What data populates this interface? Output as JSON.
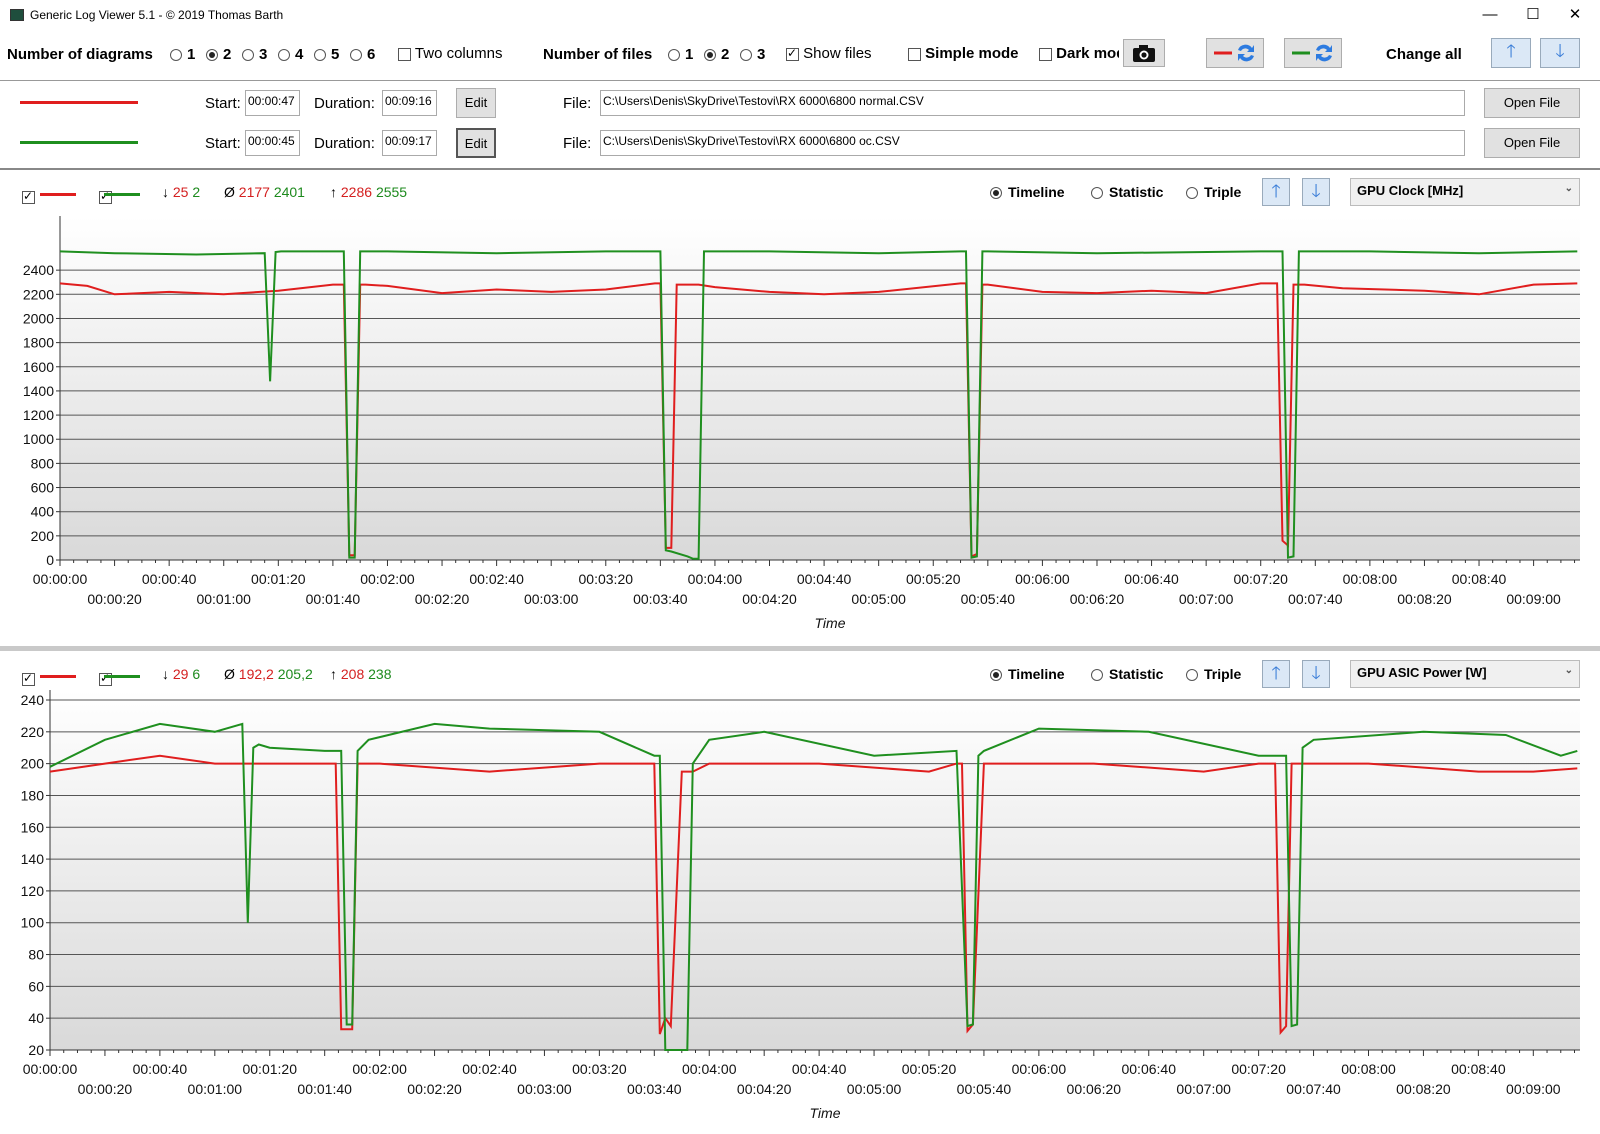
{
  "window": {
    "title": "Generic Log Viewer 5.1 - © 2019 Thomas Barth",
    "minimize": "—",
    "maximize": "☐",
    "close": "✕"
  },
  "toolbar": {
    "num_diagrams_label": "Number of diagrams",
    "diagram_options": [
      "1",
      "2",
      "3",
      "4",
      "5",
      "6"
    ],
    "diagram_selected": "2",
    "two_columns_label": "Two columns",
    "num_files_label": "Number of files",
    "file_options": [
      "1",
      "2",
      "3"
    ],
    "file_selected": "2",
    "show_files_label": "Show files",
    "show_files_checked": true,
    "simple_mode_label": "Simple mode",
    "dark_mode_label": "Dark mod",
    "change_all_label": "Change all"
  },
  "files": [
    {
      "color": "#e01e1e",
      "start_label": "Start:",
      "start": "00:00:47",
      "duration_label": "Duration:",
      "duration": "00:09:16",
      "edit": "Edit",
      "file_label": "File:",
      "path": "C:\\Users\\Denis\\SkyDrive\\Testovi\\RX 6000\\6800 normal.CSV",
      "open": "Open File"
    },
    {
      "color": "#1f8f1f",
      "start_label": "Start:",
      "start": "00:00:45",
      "duration_label": "Duration:",
      "duration": "00:09:17",
      "edit": "Edit",
      "file_label": "File:",
      "path": "C:\\Users\\Denis\\SkyDrive\\Testovi\\RX 6000\\6800 oc.CSV",
      "open": "Open File"
    }
  ],
  "diagrams": [
    {
      "stats": {
        "min_red": "25",
        "min_green": "2",
        "avg_red": "2177",
        "avg_green": "2401",
        "max_red": "2286",
        "max_green": "2555",
        "min_sym": "↓",
        "avg_sym": "Ø",
        "max_sym": "↑"
      },
      "modes": [
        "Timeline",
        "Statistic",
        "Triple"
      ],
      "mode_selected": "Timeline",
      "sensor": "GPU Clock [MHz]",
      "xlabel": "Time"
    },
    {
      "stats": {
        "min_red": "29",
        "min_green": "6",
        "avg_red": "192,2",
        "avg_green": "205,2",
        "max_red": "208",
        "max_green": "238",
        "min_sym": "↓",
        "avg_sym": "Ø",
        "max_sym": "↑"
      },
      "modes": [
        "Timeline",
        "Statistic",
        "Triple"
      ],
      "mode_selected": "Timeline",
      "sensor": "GPU ASIC Power [W]",
      "xlabel": "Time"
    }
  ],
  "chart_data": [
    {
      "type": "line",
      "ylim": [
        0,
        2600
      ],
      "yticks": [
        0,
        200,
        400,
        600,
        800,
        1000,
        1200,
        1400,
        1600,
        1800,
        2000,
        2200,
        2400
      ],
      "xlim": [
        0,
        557
      ],
      "xticks_top": [
        "00:00:00",
        "00:00:40",
        "00:01:20",
        "00:02:00",
        "00:02:40",
        "00:03:20",
        "00:04:00",
        "00:04:40",
        "00:05:20",
        "00:06:00",
        "00:06:40",
        "00:07:20",
        "00:08:00",
        "00:08:40"
      ],
      "xticks_bottom": [
        "00:00:20",
        "00:01:00",
        "00:01:40",
        "00:02:20",
        "00:03:00",
        "00:03:40",
        "00:04:20",
        "00:05:00",
        "00:05:40",
        "00:06:20",
        "00:07:00",
        "00:07:40",
        "00:08:20",
        "00:09:00"
      ],
      "xlabel": "Time",
      "ylabel": "GPU Clock [MHz]",
      "grid": true,
      "series": [
        {
          "name": "6800 normal.CSV",
          "color": "#e01e1e",
          "x": [
            0,
            10,
            20,
            40,
            60,
            80,
            100,
            104,
            106,
            108,
            110,
            112,
            120,
            140,
            160,
            180,
            200,
            218,
            220,
            222,
            224,
            226,
            234,
            240,
            260,
            280,
            300,
            330,
            332,
            334,
            336,
            338,
            340,
            360,
            380,
            400,
            420,
            440,
            446,
            448,
            450,
            452,
            454,
            456,
            470,
            500,
            520,
            540,
            556
          ],
          "y": [
            2290,
            2270,
            2200,
            2220,
            2200,
            2230,
            2280,
            2280,
            40,
            40,
            2280,
            2280,
            2270,
            2210,
            2240,
            2220,
            2240,
            2290,
            2290,
            100,
            100,
            2280,
            2280,
            2260,
            2220,
            2200,
            2220,
            2290,
            2290,
            30,
            50,
            2280,
            2280,
            2220,
            2210,
            2230,
            2210,
            2290,
            2290,
            160,
            120,
            2280,
            2280,
            2280,
            2250,
            2230,
            2200,
            2280,
            2290
          ]
        },
        {
          "name": "6800 oc.CSV",
          "color": "#1f8f1f",
          "x": [
            0,
            20,
            50,
            75,
            77,
            79,
            81,
            83,
            100,
            104,
            106,
            108,
            110,
            112,
            120,
            160,
            200,
            220,
            222,
            224,
            230,
            232,
            234,
            236,
            240,
            260,
            300,
            330,
            332,
            334,
            336,
            338,
            340,
            380,
            440,
            446,
            448,
            450,
            452,
            454,
            456,
            480,
            520,
            556
          ],
          "y": [
            2555,
            2540,
            2530,
            2540,
            1480,
            2550,
            2555,
            2555,
            2555,
            2555,
            20,
            20,
            2555,
            2555,
            2555,
            2540,
            2555,
            2555,
            80,
            70,
            30,
            10,
            10,
            2555,
            2555,
            2555,
            2540,
            2555,
            2555,
            20,
            30,
            2555,
            2555,
            2540,
            2555,
            2555,
            2555,
            20,
            30,
            2555,
            2555,
            2555,
            2540,
            2555
          ]
        }
      ]
    },
    {
      "type": "line",
      "ylim": [
        20,
        240
      ],
      "yticks": [
        20,
        40,
        60,
        80,
        100,
        120,
        140,
        160,
        180,
        200,
        220,
        240
      ],
      "xlim": [
        0,
        557
      ],
      "xticks_top": [
        "00:00:00",
        "00:00:40",
        "00:01:20",
        "00:02:00",
        "00:02:40",
        "00:03:20",
        "00:04:00",
        "00:04:40",
        "00:05:20",
        "00:06:00",
        "00:06:40",
        "00:07:20",
        "00:08:00",
        "00:08:40"
      ],
      "xticks_bottom": [
        "00:00:20",
        "00:01:00",
        "00:01:40",
        "00:02:20",
        "00:03:00",
        "00:03:40",
        "00:04:20",
        "00:05:00",
        "00:05:40",
        "00:06:20",
        "00:07:00",
        "00:07:40",
        "00:08:20",
        "00:09:00"
      ],
      "xlabel": "Time",
      "ylabel": "GPU ASIC Power [W]",
      "grid": true,
      "series": [
        {
          "name": "6800 normal.CSV",
          "color": "#e01e1e",
          "x": [
            0,
            20,
            40,
            60,
            80,
            100,
            104,
            106,
            110,
            112,
            120,
            160,
            200,
            220,
            222,
            224,
            226,
            230,
            234,
            240,
            280,
            320,
            330,
            332,
            334,
            336,
            340,
            380,
            420,
            440,
            446,
            448,
            450,
            452,
            456,
            480,
            520,
            540,
            556
          ],
          "y": [
            195,
            200,
            205,
            200,
            200,
            200,
            200,
            33,
            33,
            200,
            200,
            195,
            200,
            200,
            30,
            40,
            35,
            195,
            195,
            200,
            200,
            195,
            200,
            200,
            32,
            36,
            200,
            200,
            195,
            200,
            200,
            31,
            35,
            200,
            200,
            200,
            195,
            195,
            197
          ]
        },
        {
          "name": "6800 oc.CSV",
          "color": "#1f8f1f",
          "x": [
            0,
            20,
            40,
            60,
            70,
            72,
            74,
            76,
            80,
            100,
            106,
            108,
            110,
            112,
            116,
            140,
            160,
            200,
            220,
            222,
            224,
            228,
            230,
            232,
            234,
            236,
            240,
            260,
            300,
            330,
            334,
            336,
            338,
            340,
            360,
            400,
            440,
            450,
            452,
            454,
            456,
            460,
            500,
            530,
            550,
            556
          ],
          "y": [
            198,
            215,
            225,
            220,
            225,
            100,
            210,
            212,
            210,
            208,
            208,
            36,
            36,
            208,
            215,
            225,
            222,
            220,
            205,
            205,
            5,
            5,
            10,
            5,
            200,
            205,
            215,
            220,
            205,
            208,
            35,
            36,
            205,
            208,
            222,
            220,
            205,
            205,
            35,
            36,
            210,
            215,
            220,
            218,
            205,
            208
          ]
        }
      ]
    }
  ]
}
